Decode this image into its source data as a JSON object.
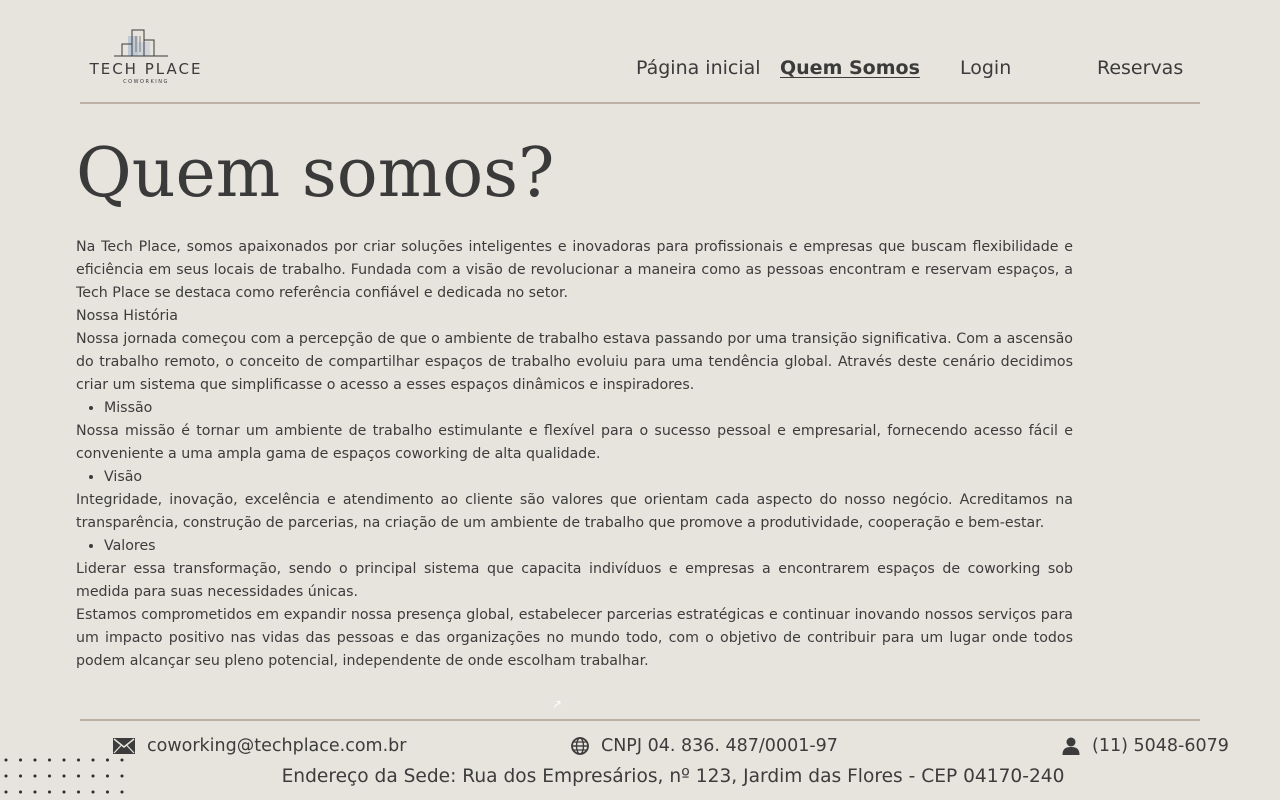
{
  "header": {
    "logo": {
      "name": "TECH PLACE",
      "subtitle": "COWORKING"
    },
    "nav": [
      {
        "label": "Página inicial",
        "active": false
      },
      {
        "label": "Quem Somos",
        "active": true
      },
      {
        "label": "Login",
        "active": false
      },
      {
        "label": "Reservas",
        "active": false
      }
    ]
  },
  "main": {
    "title": "Quem somos?",
    "intro": "Na Tech Place, somos apaixonados por criar soluções inteligentes e inovadoras para profissionais e empresas que buscam flexibilidade e eficiência em seus locais de trabalho. Fundada com a visão de revolucionar a maneira como as pessoas encontram e reservam espaços, a Tech Place se destaca como referência confiável e dedicada no setor.",
    "history_heading": "Nossa História",
    "history_text": "Nossa jornada começou com a percepção de que o ambiente de trabalho estava passando por uma transição significativa. Com a ascensão do trabalho remoto, o conceito de compartilhar espaços de trabalho evoluiu para uma tendência global. Através deste cenário decidimos criar um sistema que simplificasse o acesso a esses espaços dinâmicos e inspiradores.",
    "mission_heading": "Missão",
    "mission_text": "Nossa missão é tornar um ambiente de trabalho estimulante e flexível para o sucesso pessoal e empresarial, fornecendo acesso fácil e conveniente a uma ampla gama de espaços coworking de alta qualidade.",
    "vision_heading": "Visão",
    "vision_text": "Integridade, inovação, excelência e atendimento ao cliente são valores que orientam cada aspecto do nosso negócio. Acreditamos na transparência, construção de parcerias, na criação de um ambiente de trabalho que promove a produtividade, cooperação e bem-estar.",
    "values_heading": "Valores",
    "values_text": "Liderar essa transformação, sendo o principal sistema que capacita indivíduos e empresas a encontrarem espaços de coworking sob medida para suas necessidades únicas.",
    "closing_text": "Estamos comprometidos em expandir nossa presença global, estabelecer parcerias estratégicas e continuar inovando nossos serviços para um impacto positivo nas vidas das pessoas e das organizações no mundo todo, com o objetivo de contribuir para um lugar onde todos podem alcançar seu pleno potencial, independente de onde escolham trabalhar."
  },
  "footer": {
    "email": "coworking@techplace.com.br",
    "cnpj": "CNPJ 04. 836. 487/0001-97",
    "phone": "(11) 5048-6079",
    "address": "Endereço da Sede: Rua dos Empresários, nº 123, Jardim das Flores - CEP 04170-240",
    "icons": {
      "email": "envelope-icon",
      "cnpj": "globe-icon",
      "phone": "person-icon",
      "arrow": "arrow-up-right-icon",
      "decoration": "dot-grid"
    }
  },
  "colors": {
    "background": "#e7e3dd",
    "text": "#3c3c3c",
    "divider": "#bcb1a4",
    "logo_accent": "#b7c3d6"
  }
}
